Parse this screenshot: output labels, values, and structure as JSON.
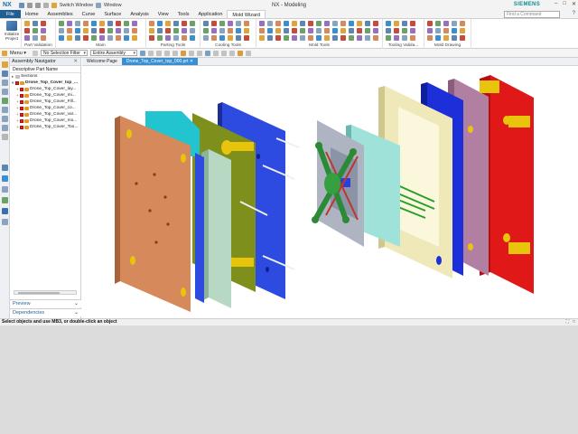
{
  "titlebar": {
    "logo": "NX",
    "switch_window": "Switch Window",
    "window_menu": "Window",
    "title": "NX - Modeling",
    "brand": "SIEMENS",
    "minimize": "–",
    "maximize": "□",
    "close": "✕"
  },
  "tabs": {
    "file": "File",
    "items": [
      "Home",
      "Assemblies",
      "Curve",
      "Surface",
      "Analysis",
      "View",
      "Tools",
      "Application",
      "Mold Wizard"
    ],
    "search_placeholder": "Find a Command",
    "help": "?"
  },
  "ribbon": {
    "initialize_project": "Initialize Project",
    "groups": [
      "Part Validation",
      "Main",
      "Parting Tools",
      "Cooling Tools",
      "Mold Tools",
      "Tooling Valida...",
      "Mold Drawing"
    ]
  },
  "commandbar": {
    "menu": "Menu ▾",
    "selection_filter": "No Selection Filter",
    "assembly_scope": "Entire Assembly"
  },
  "navigator": {
    "title": "Assembly Navigator",
    "column_header": "Descriptive Part Name",
    "rows": [
      "Sections",
      "Drone_Top_Cover_top_...",
      "Drone_Top_Cover_lay...",
      "Drone_Top_Cover_mi...",
      "Drone_Top_Cover_Fill...",
      "Drone_Top_Cover_co...",
      "Drone_Top_Cover_var...",
      "Drone_Top_Cover_mo...",
      "Drone_Top_Cover_Too..."
    ],
    "preview": "Preview",
    "dependencies": "Dependencies"
  },
  "doctabs": {
    "welcome": "Welcome Page",
    "active": "Drone_Top_Cover_top_000.prt"
  },
  "status": {
    "message": "Select objects and use MB3, or double-click an object"
  },
  "colors": {
    "accent": "#1f5f95",
    "doc_tab": "#3a8fd1",
    "brand": "#0f8c8c"
  }
}
